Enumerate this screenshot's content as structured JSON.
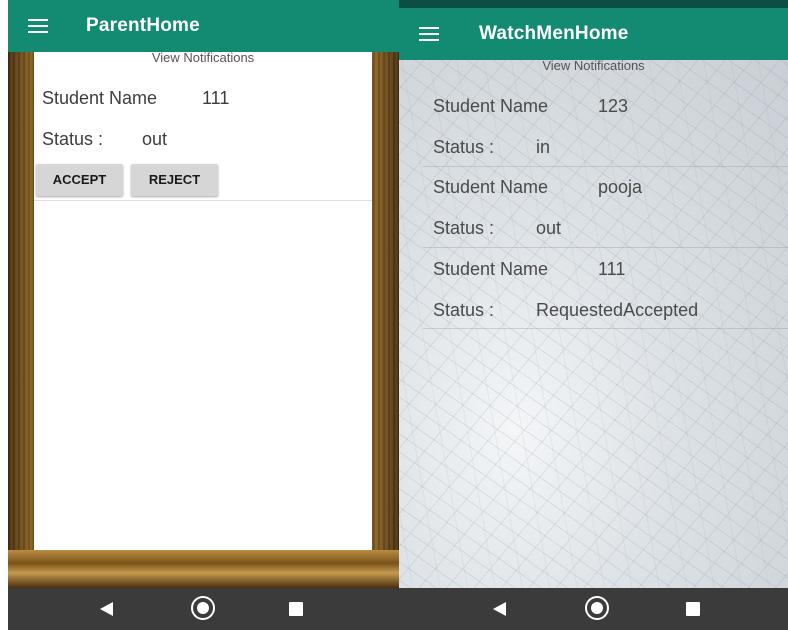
{
  "parent": {
    "title": "ParentHome",
    "view_notifications": "View Notifications",
    "record": {
      "name_label": "Student Name",
      "name_value": "111",
      "status_label": "Status :",
      "status_value": "out"
    },
    "buttons": {
      "accept": "ACCEPT",
      "reject": "REJECT"
    }
  },
  "watchmen": {
    "title": "WatchMenHome",
    "view_notifications": "View Notifications",
    "records": [
      {
        "name_label": "Student Name",
        "name_value": "123",
        "status_label": "Status :",
        "status_value": "in"
      },
      {
        "name_label": "Student Name",
        "name_value": "pooja",
        "status_label": "Status :",
        "status_value": "out"
      },
      {
        "name_label": "Student Name",
        "name_value": "111",
        "status_label": "Status :",
        "status_value": "RequestedAccepted"
      }
    ]
  },
  "colors": {
    "appbar": "#138a72",
    "statusbar": "#0b4f42",
    "navbar": "#3b3b3b",
    "button": "#d6d6d6"
  },
  "icons": {
    "menu": "hamburger-icon",
    "back": "back-triangle-icon",
    "home": "home-circle-icon",
    "recents": "recents-square-icon"
  }
}
